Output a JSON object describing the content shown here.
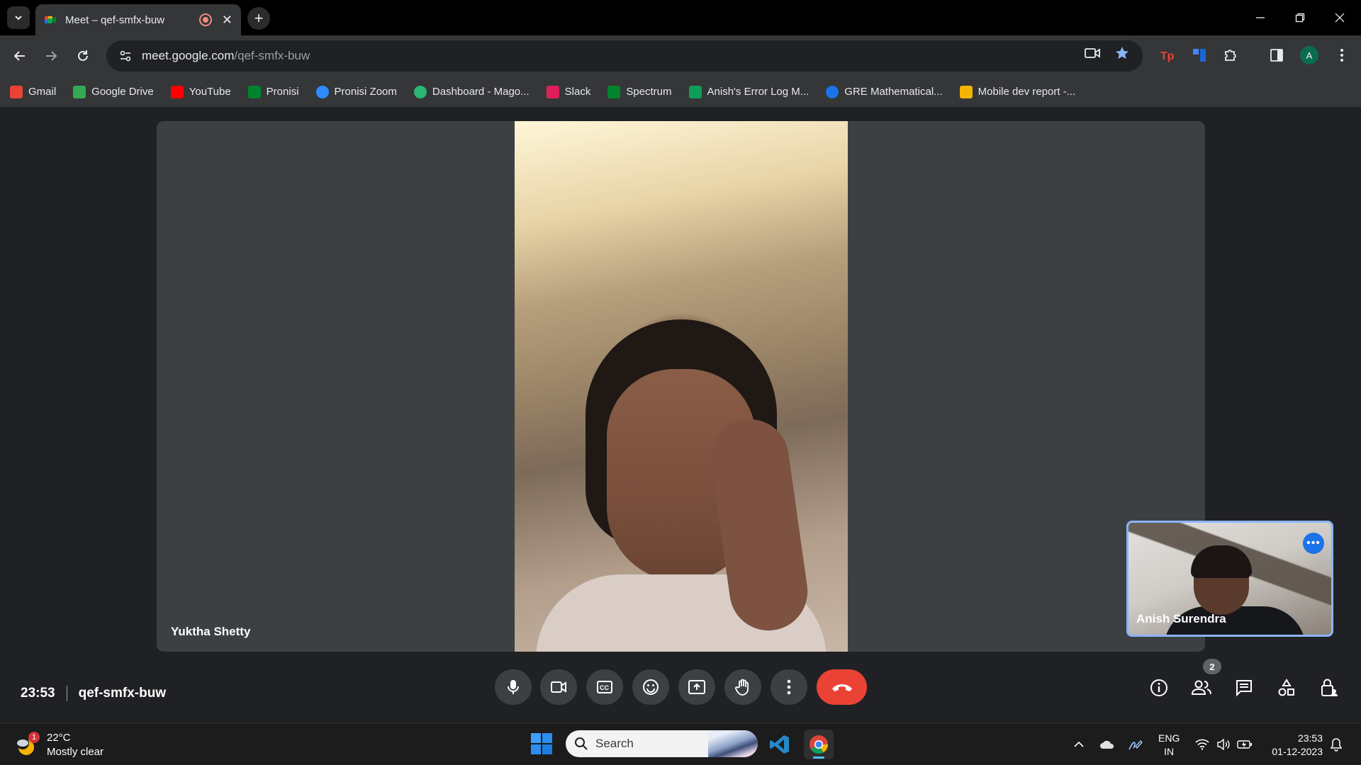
{
  "browser": {
    "tab_title": "Meet – qef-smfx-buw",
    "url_host": "meet.google.com",
    "url_path": "/qef-smfx-buw",
    "profile_initial": "A",
    "bookmarks": [
      {
        "label": "Gmail",
        "icon_color": "#ea4335"
      },
      {
        "label": "Google Drive",
        "icon_color": "#34a853"
      },
      {
        "label": "YouTube",
        "icon_color": "#ff0000"
      },
      {
        "label": "Pronisi",
        "icon_color": "#00832d"
      },
      {
        "label": "Pronisi Zoom",
        "icon_color": "#2d8cff"
      },
      {
        "label": "Dashboard - Mago...",
        "icon_color": "#2bb673"
      },
      {
        "label": "Slack",
        "icon_color": "#e01e5a"
      },
      {
        "label": "Spectrum",
        "icon_color": "#00832d"
      },
      {
        "label": "Anish's Error Log M...",
        "icon_color": "#0f9d58"
      },
      {
        "label": "GRE Mathematical...",
        "icon_color": "#1a73e8"
      },
      {
        "label": "Mobile dev report -...",
        "icon_color": "#f4b400"
      }
    ]
  },
  "meet": {
    "main_participant": "Yuktha Shetty",
    "self_participant": "Anish Surendra",
    "time": "23:53",
    "meeting_code": "qef-smfx-buw",
    "participant_count": "2",
    "controls": [
      "mic-icon",
      "camera-icon",
      "captions-icon",
      "emoji-icon",
      "present-icon",
      "raise-hand-icon",
      "more-options-icon"
    ],
    "leave_color": "#ea4335"
  },
  "taskbar": {
    "temperature": "22°C",
    "weather": "Mostly clear",
    "weather_badge": "1",
    "search_placeholder": "Search",
    "lang_line1": "ENG",
    "lang_line2": "IN",
    "time": "23:53",
    "date": "01-12-2023"
  }
}
